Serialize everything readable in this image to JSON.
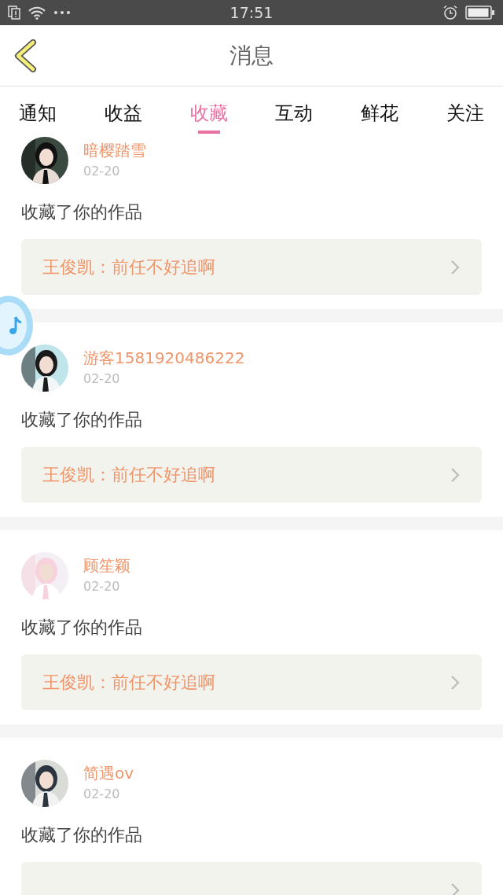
{
  "status_bar": {
    "time": "17:51"
  },
  "header": {
    "title": "消息"
  },
  "tabs": [
    {
      "label": "通知",
      "selected": false
    },
    {
      "label": "收益",
      "selected": false
    },
    {
      "label": "收藏",
      "selected": true
    },
    {
      "label": "互动",
      "selected": false
    },
    {
      "label": "鲜花",
      "selected": false
    },
    {
      "label": "关注",
      "selected": false
    }
  ],
  "messages": [
    {
      "name": "暗樱踏雪",
      "date": "02-20",
      "text": "收藏了你的作品",
      "work": "王俊凯：前任不好追啊"
    },
    {
      "name": "游客1581920486222",
      "date": "02-20",
      "text": "收藏了你的作品",
      "work": "王俊凯：前任不好追啊"
    },
    {
      "name": "顾笙颖",
      "date": "02-20",
      "text": "收藏了你的作品",
      "work": "王俊凯：前任不好追啊"
    },
    {
      "name": "简遇ov",
      "date": "02-20",
      "text": "收藏了你的作品"
    }
  ]
}
